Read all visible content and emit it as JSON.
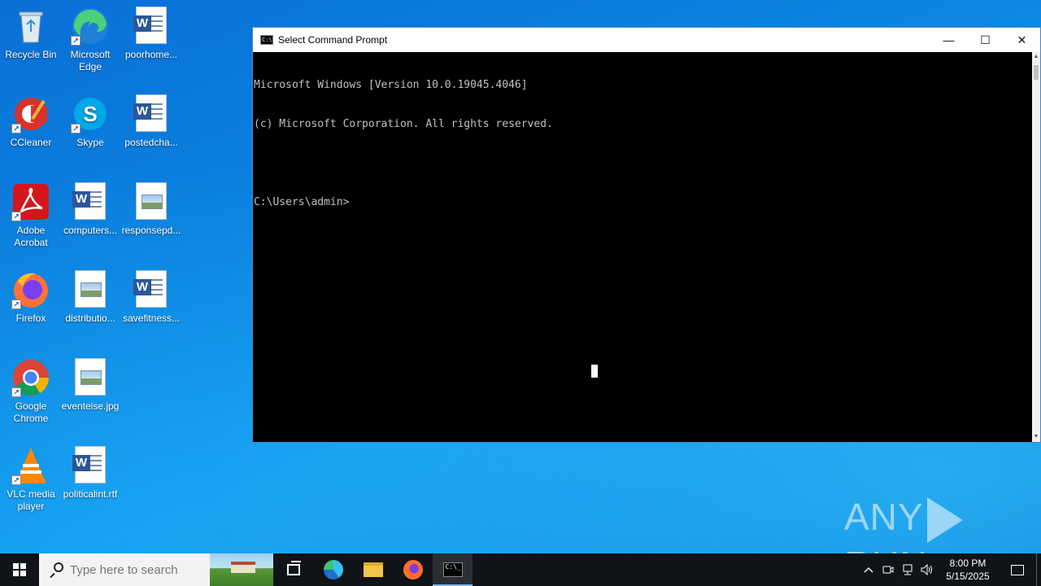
{
  "desktop": {
    "icons": [
      {
        "label": "Recycle Bin",
        "icon": "recycle-bin-icon"
      },
      {
        "label": "Microsoft Edge",
        "icon": "edge-icon"
      },
      {
        "label": "poorhome...",
        "icon": "word-doc-icon"
      },
      {
        "label": "CCleaner",
        "icon": "ccleaner-icon"
      },
      {
        "label": "Skype",
        "icon": "skype-icon"
      },
      {
        "label": "postedcha...",
        "icon": "word-doc-icon"
      },
      {
        "label": "Adobe Acrobat",
        "icon": "acrobat-icon"
      },
      {
        "label": "computers...",
        "icon": "word-doc-icon"
      },
      {
        "label": "responsepd...",
        "icon": "image-file-icon"
      },
      {
        "label": "Firefox",
        "icon": "firefox-icon"
      },
      {
        "label": "distributio...",
        "icon": "image-file-icon"
      },
      {
        "label": "savefitness...",
        "icon": "word-doc-icon"
      },
      {
        "label": "Google Chrome",
        "icon": "chrome-icon"
      },
      {
        "label": "eventelse.jpg",
        "icon": "image-file-icon"
      },
      {
        "label": "VLC media player",
        "icon": "vlc-icon"
      },
      {
        "label": "politicalint.rtf",
        "icon": "word-doc-icon"
      }
    ]
  },
  "cmd_window": {
    "title": "Select Command Prompt",
    "lines": [
      "Microsoft Windows [Version 10.0.19045.4046]",
      "(c) Microsoft Corporation. All rights reserved.",
      "",
      "C:\\Users\\admin>"
    ],
    "minimize_glyph": "—",
    "maximize_glyph": "☐",
    "close_glyph": "✕"
  },
  "watermark": {
    "left": "ANY",
    "right": "RUN"
  },
  "taskbar": {
    "search_placeholder": "Type here to search",
    "pinned": [
      {
        "name": "task-view",
        "icon": "task-view-icon"
      },
      {
        "name": "edge",
        "icon": "edge-icon"
      },
      {
        "name": "file-explorer",
        "icon": "folder-icon"
      },
      {
        "name": "firefox",
        "icon": "firefox-icon"
      },
      {
        "name": "command-prompt",
        "icon": "cmd-icon",
        "active": true
      }
    ],
    "tray": {
      "time": "8:00 PM",
      "date": "5/15/2025"
    }
  },
  "colors": {
    "desktop_blue": "#0b84e0",
    "taskbar": "#101317",
    "console_bg": "#000000",
    "console_text": "#c0c0c0"
  }
}
